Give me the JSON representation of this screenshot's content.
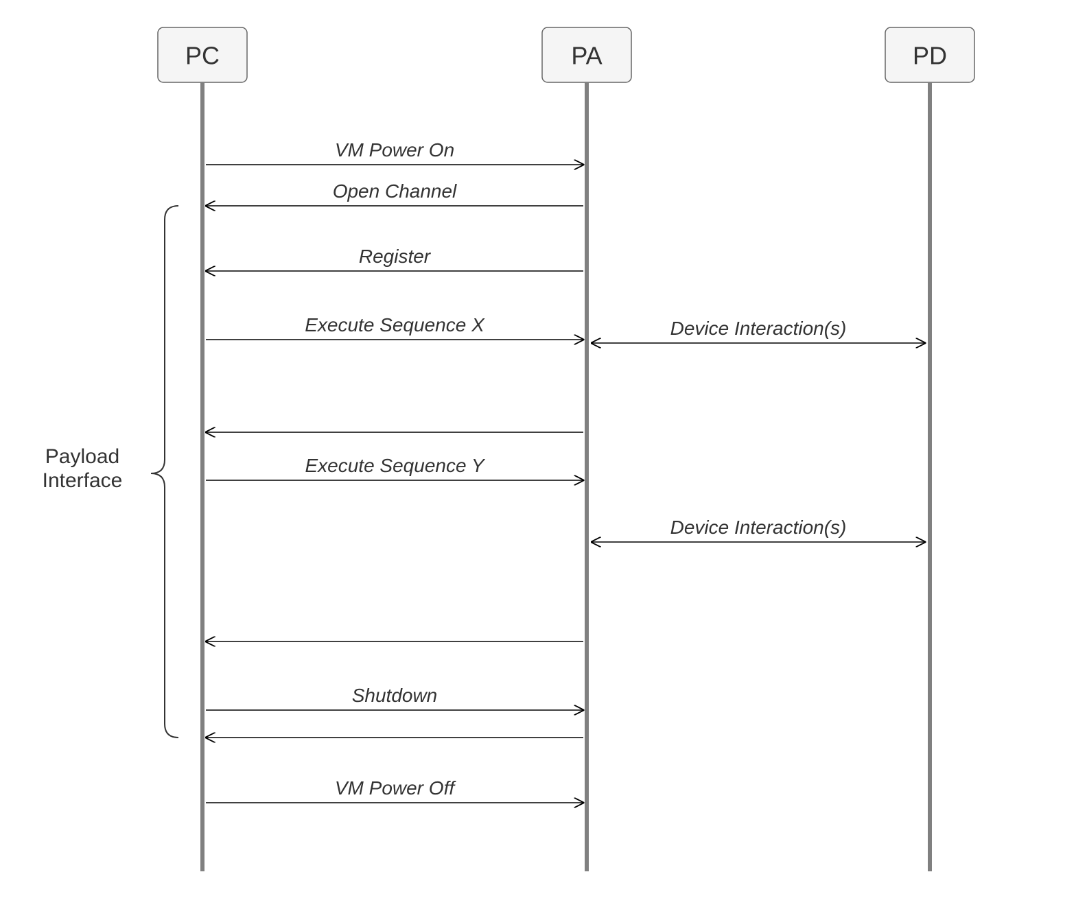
{
  "actors": {
    "pc": "PC",
    "pa": "PA",
    "pd": "PD"
  },
  "messages": {
    "m1": "VM Power On",
    "m2": "Open Channel",
    "m3": "Register",
    "m4": "Execute Sequence X",
    "m5": "Device Interaction(s)",
    "m6": "Execute Sequence Y",
    "m7": "Device Interaction(s)",
    "m8": "Shutdown",
    "m9": "VM Power Off"
  },
  "brace_label_line1": "Payload",
  "brace_label_line2": "Interface"
}
